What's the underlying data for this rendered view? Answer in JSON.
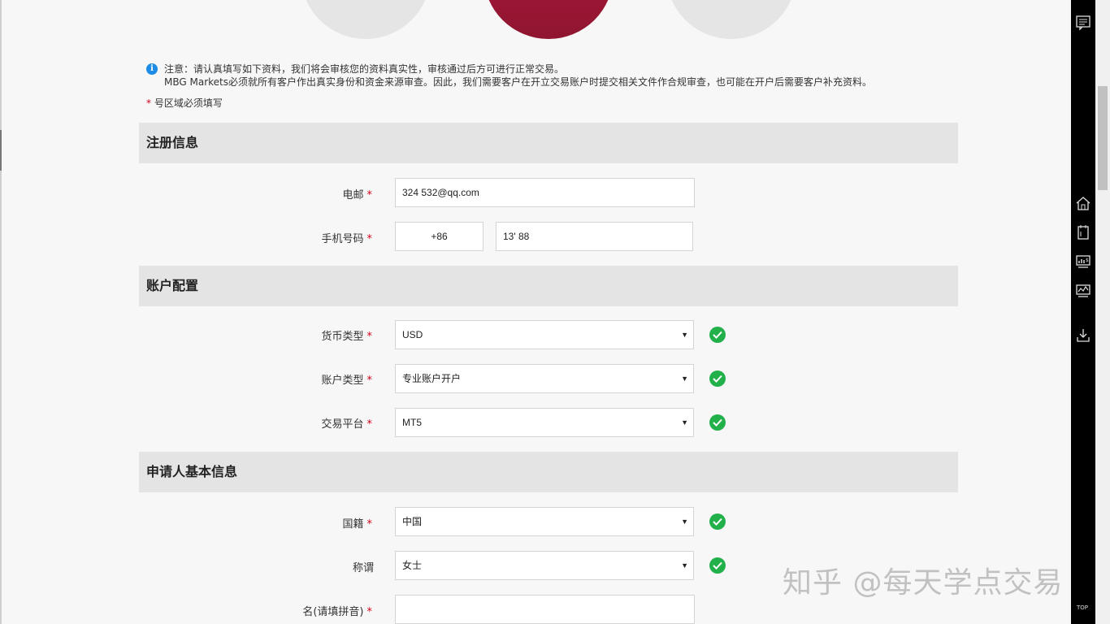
{
  "notice": {
    "icon": "info-icon",
    "line1": "注意：请认真填写如下资料，我们将会审核您的资料真实性，审核通过后方可进行正常交易。",
    "line2": "MBG Markets必须就所有客户作出真实身份和资金来源审查。因此，我们需要客户在开立交易账户时提交相关文件作合规审查，也可能在开户后需要客户补充资料。"
  },
  "required_note": {
    "star": "*",
    "text": "号区域必须填写"
  },
  "sections": {
    "registration": {
      "title": "注册信息",
      "email_label": "电邮",
      "email_value": "324          532@qq.com",
      "phone_label": "手机号码",
      "phone_code": "+86",
      "phone_value": "13'             88"
    },
    "account": {
      "title": "账户配置",
      "currency_label": "货币类型",
      "currency_value": "USD",
      "account_type_label": "账户类型",
      "account_type_value": "专业账户开户",
      "platform_label": "交易平台",
      "platform_value": "MT5"
    },
    "applicant": {
      "title": "申请人基本信息",
      "nationality_label": "国籍",
      "nationality_value": "中国",
      "title_label": "称谓",
      "title_value": "女士",
      "firstname_label": "名(请填拼音)",
      "firstname_value": ""
    }
  },
  "required_star": "*",
  "toolbar": {
    "icons": [
      "feedback-icon",
      "home-icon",
      "documents-icon",
      "chart-dollar-icon",
      "monitor-chart-icon",
      "download-icon"
    ],
    "top_label": "TOP"
  },
  "watermark": "知乎 @每天学点交易",
  "colors": {
    "accent": "#a3193a",
    "check": "#22b04a",
    "required": "#d0021b",
    "section_bg": "#e4e4e4"
  }
}
